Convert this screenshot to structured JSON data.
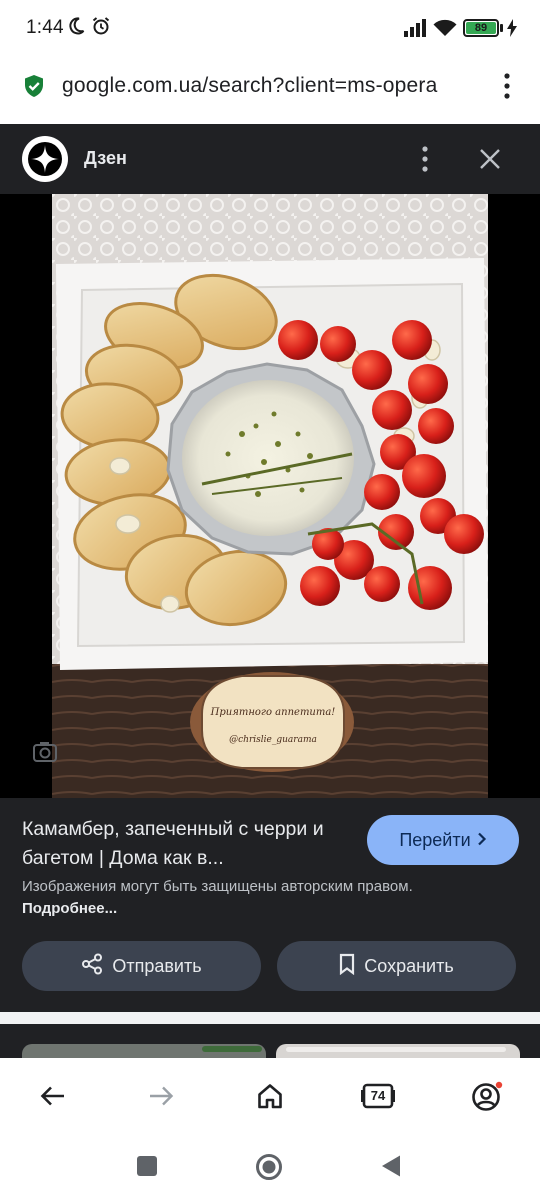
{
  "status_bar": {
    "time": "1:44",
    "battery_level": "89"
  },
  "url_bar": {
    "url": "google.com.ua/search?client=ms-opera"
  },
  "viewer": {
    "source_name": "Дзен",
    "photo_label_line1": "Приятного аппетита!",
    "photo_label_line2": "@chrislie_guarama",
    "caption_title": "Камамбер, запеченный с черри и багетом | Дома как в...",
    "go_button_label": "Перейти",
    "copyright_text": "Изображения могут быть защищены авторским правом.",
    "copyright_link": "Подробнее...",
    "share_button_label": "Отправить",
    "save_button_label": "Сохранить"
  },
  "bottom_nav": {
    "tab_count": "74"
  },
  "colors": {
    "overlay_background": "#202124",
    "go_button": "#8ab4f8",
    "pill_button": "#3c4350",
    "secure_icon": "#188038",
    "battery_fill": "#34a853",
    "notification_dot": "#ea4335"
  }
}
